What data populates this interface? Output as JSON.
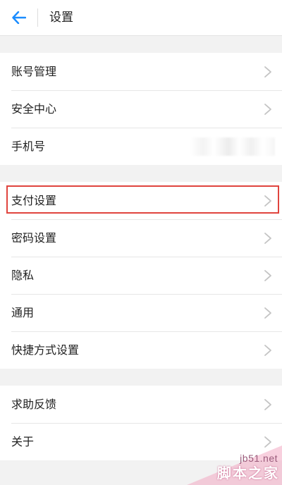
{
  "header": {
    "title": "设置",
    "back_icon": "arrow-left-icon",
    "accent_color": "#1a8cff"
  },
  "groups": [
    {
      "items": [
        {
          "label": "账号管理"
        },
        {
          "label": "安全中心"
        },
        {
          "label": "手机号"
        }
      ]
    },
    {
      "items": [
        {
          "label": "支付设置",
          "highlighted": true
        },
        {
          "label": "密码设置"
        },
        {
          "label": "隐私"
        },
        {
          "label": "通用"
        },
        {
          "label": "快捷方式设置"
        }
      ]
    },
    {
      "items": [
        {
          "label": "求助反馈"
        },
        {
          "label": "关于"
        }
      ]
    }
  ],
  "annotation": {
    "highlight_color": "#e0443e"
  },
  "watermark": {
    "site": "jb51.net",
    "name": "脚本之家"
  }
}
